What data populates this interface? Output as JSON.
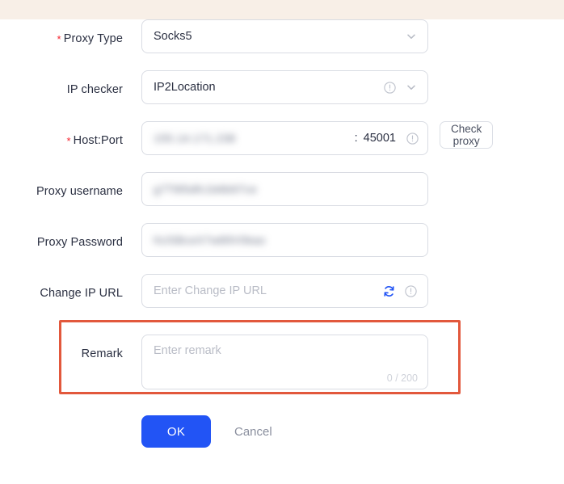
{
  "theme": {
    "top_strip_color": "#f8efe7",
    "primary_button_color": "#2254f5",
    "highlight_border_color": "#e2583c",
    "required_star_color": "#f5222d",
    "border_color": "#d9dce3",
    "placeholder_color": "#b9bcc6"
  },
  "form": {
    "rows": {
      "proxy_type": {
        "label": "Proxy Type",
        "required": true,
        "value": "Socks5",
        "chevron": "chevron-down-icon"
      },
      "ip_checker": {
        "label": "IP checker",
        "required": false,
        "value": "IP2Location",
        "info": "info-circle-icon",
        "chevron": "chevron-down-icon"
      },
      "host_port": {
        "label": "Host:Port",
        "required": true,
        "host_value": "155.14.171.238",
        "host_redacted": true,
        "separator": ":",
        "port_value": "45001",
        "info": "info-circle-icon",
        "check_button_label": "Check proxy"
      },
      "proxy_username": {
        "label": "Proxy username",
        "required": false,
        "value": "g7T8l5dfc1b6b97ce",
        "redacted": true
      },
      "proxy_password": {
        "label": "Proxy Password",
        "required": false,
        "value": "hUSBceX7w89V0kao",
        "redacted": true
      },
      "change_ip_url": {
        "label": "Change IP URL",
        "required": false,
        "value": "",
        "placeholder": "Enter Change IP URL",
        "refresh": "refresh-icon",
        "info": "info-circle-icon"
      },
      "remark": {
        "label": "Remark",
        "required": false,
        "value": "",
        "placeholder": "Enter remark",
        "counter": "0 / 200",
        "highlighted": true
      }
    }
  },
  "footer": {
    "ok_label": "OK",
    "cancel_label": "Cancel"
  }
}
